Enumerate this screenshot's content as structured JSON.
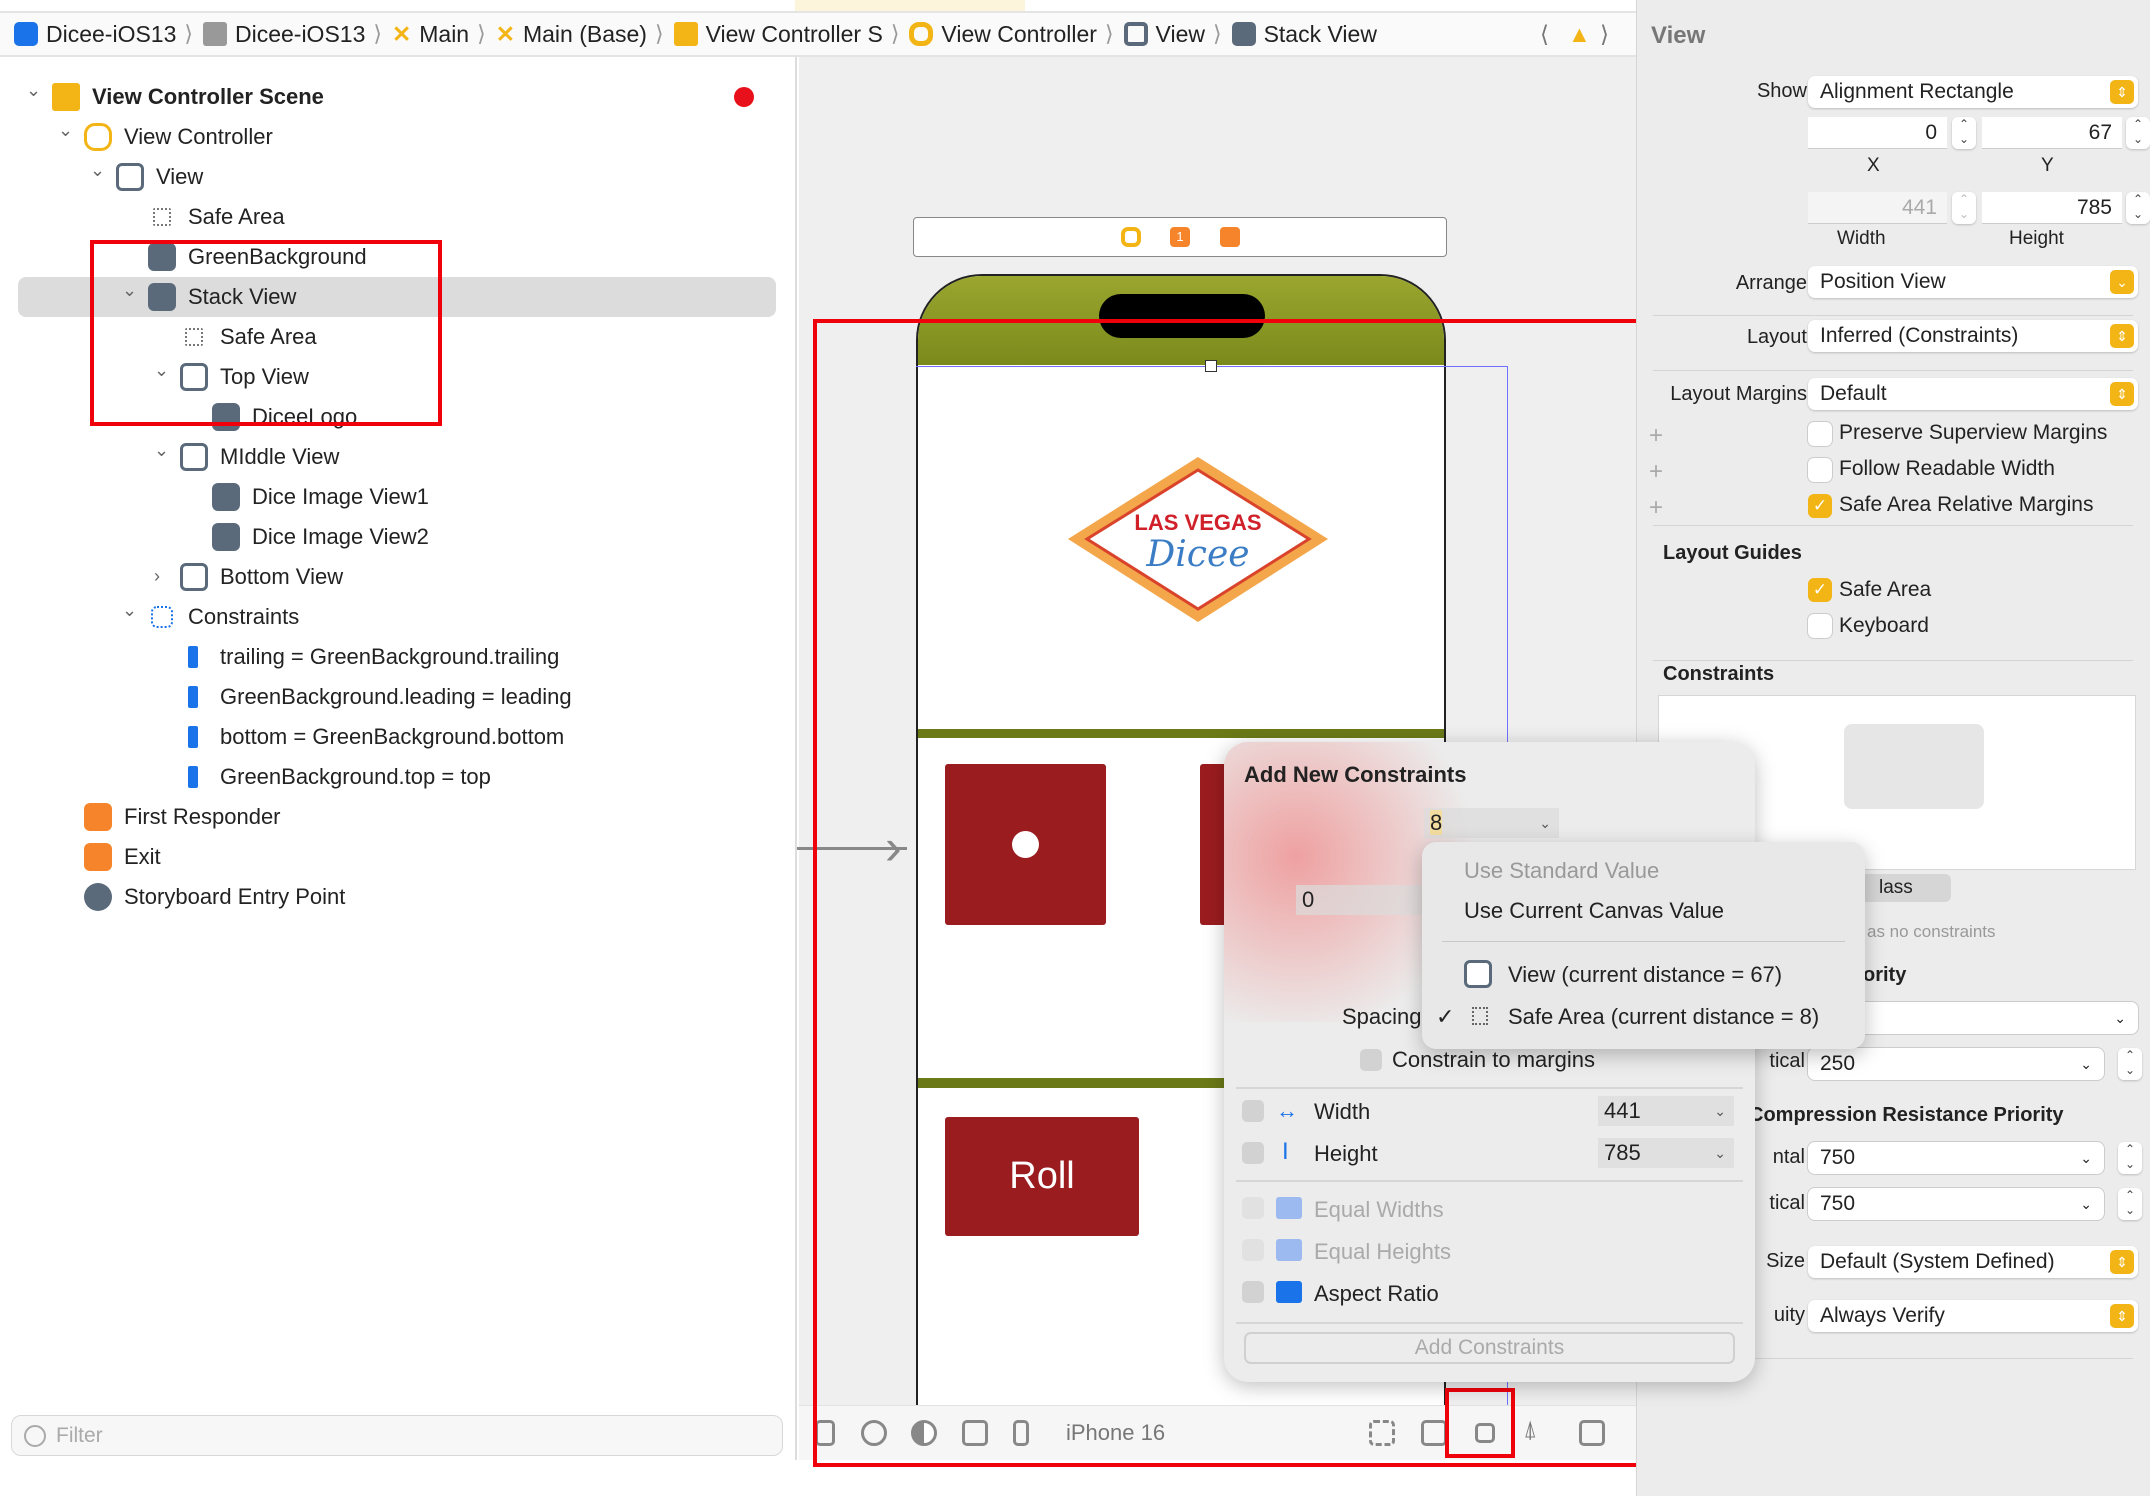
{
  "breadcrumbs": [
    {
      "label": "Dicee-iOS13",
      "icon": "app-icon"
    },
    {
      "label": "Dicee-iOS13",
      "icon": "folder-icon"
    },
    {
      "label": "Main",
      "icon": "storyboard-icon"
    },
    {
      "label": "Main (Base)",
      "icon": "storyboard-icon"
    },
    {
      "label": "View Controller S",
      "icon": "scene-icon"
    },
    {
      "label": "View Controller",
      "icon": "view-controller-icon"
    },
    {
      "label": "View",
      "icon": "view-icon"
    },
    {
      "label": "Stack View",
      "icon": "stack-view-icon"
    }
  ],
  "outline": {
    "items": [
      {
        "label": "View Controller Scene",
        "level": 0,
        "chev": "v",
        "icon": "scene"
      },
      {
        "label": "View Controller",
        "level": 1,
        "chev": "v",
        "icon": "vc"
      },
      {
        "label": "View",
        "level": 2,
        "chev": "v",
        "icon": "view"
      },
      {
        "label": "Safe Area",
        "level": 3,
        "chev": "",
        "icon": "safe"
      },
      {
        "label": "GreenBackground",
        "level": 3,
        "chev": "",
        "icon": "image"
      },
      {
        "label": "Stack View",
        "level": 3,
        "chev": "v",
        "icon": "stack",
        "selected": true
      },
      {
        "label": "Safe Area",
        "level": 4,
        "chev": "",
        "icon": "safe"
      },
      {
        "label": "Top View",
        "level": 4,
        "chev": "v",
        "icon": "view"
      },
      {
        "label": "DiceeLogo",
        "level": 5,
        "chev": "",
        "icon": "image"
      },
      {
        "label": "MIddle View",
        "level": 4,
        "chev": "v",
        "icon": "view"
      },
      {
        "label": "Dice Image View1",
        "level": 5,
        "chev": "",
        "icon": "image"
      },
      {
        "label": "Dice Image View2",
        "level": 5,
        "chev": "",
        "icon": "image"
      },
      {
        "label": "Bottom View",
        "level": 4,
        "chev": ">",
        "icon": "view"
      },
      {
        "label": "Constraints",
        "level": 3,
        "chev": "v",
        "icon": "constraints"
      },
      {
        "label": "trailing = GreenBackground.trailing",
        "level": 4,
        "chev": "",
        "icon": "constraint"
      },
      {
        "label": "GreenBackground.leading = leading",
        "level": 4,
        "chev": "",
        "icon": "constraint"
      },
      {
        "label": "bottom = GreenBackground.bottom",
        "level": 4,
        "chev": "",
        "icon": "constraint"
      },
      {
        "label": "GreenBackground.top = top",
        "level": 4,
        "chev": "",
        "icon": "constraint"
      },
      {
        "label": "First Responder",
        "level": 1,
        "chev": "",
        "icon": "first-responder"
      },
      {
        "label": "Exit",
        "level": 1,
        "chev": "",
        "icon": "exit"
      },
      {
        "label": "Storyboard Entry Point",
        "level": 1,
        "chev": "",
        "icon": "entry"
      }
    ],
    "filter_placeholder": "Filter"
  },
  "canvas": {
    "logo_line1": "LAS VEGAS",
    "logo_line2": "Dicee",
    "roll_label": "Roll",
    "device": "iPhone 16",
    "colors": {
      "green": "#7f8f1e",
      "dice": "#9b1c1f",
      "selection": "#6b6bff",
      "annotation": "#f0000a"
    }
  },
  "popover": {
    "title": "Add New Constraints",
    "top_value": "8",
    "left_value": "0",
    "spacing_label": "Spacing",
    "constrain_margins": "Constrain to margins",
    "width_label": "Width",
    "width_value": "441",
    "height_label": "Height",
    "height_value": "785",
    "equal_widths": "Equal Widths",
    "equal_heights": "Equal Heights",
    "aspect_ratio": "Aspect Ratio",
    "add_button": "Add Constraints"
  },
  "menu": {
    "standard": "Use Standard Value",
    "canvas": "Use Current Canvas Value",
    "view": "View (current distance = 67)",
    "safe_area": "Safe Area (current distance = 8)",
    "checkmark": "✓"
  },
  "inspector": {
    "title": "View",
    "show_label": "Show",
    "show_value": "Alignment Rectangle",
    "x": "0",
    "y": "67",
    "x_label": "X",
    "y_label": "Y",
    "width": "441",
    "height": "785",
    "width_label": "Width",
    "height_label": "Height",
    "arrange_label": "Arrange",
    "arrange_value": "Position View",
    "layout_label": "Layout",
    "layout_value": "Inferred (Constraints)",
    "margins_label": "Layout Margins",
    "margins_value": "Default",
    "preserve": "Preserve Superview Margins",
    "readable": "Follow Readable Width",
    "safe_rel": "Safe Area Relative Margins",
    "guides_title": "Layout Guides",
    "guide_safe": "Safe Area",
    "guide_keyboard": "Keyboard",
    "constraints_title": "Constraints",
    "class_btn": "lass",
    "no_constraints": "as no constraints",
    "hugging_title": "ority",
    "hug_vertical_label": "tical",
    "hug_vertical": "250",
    "compression_title": "Compression Resistance Priority",
    "comp_h_label": "ntal",
    "comp_h": "750",
    "comp_v_label": "tical",
    "comp_v": "750",
    "size_label": "Size",
    "size_value": "Default (System Defined)",
    "ambiguity_label": "uity",
    "ambiguity_value": "Always Verify"
  }
}
